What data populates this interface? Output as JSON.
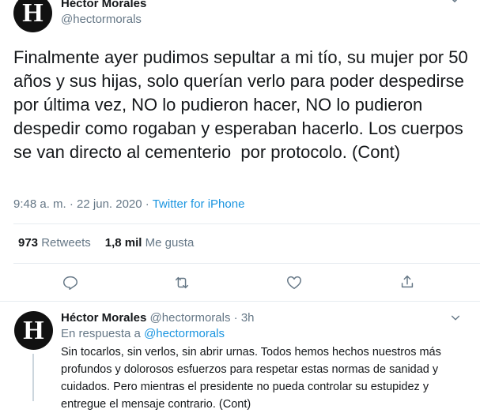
{
  "main_tweet": {
    "author_name": "Héctor Morales",
    "handle": "@hectormorals",
    "avatar_letter": "H",
    "text": "Finalmente ayer pudimos sepultar a mi tío, su mujer por 50 años y sus hijas, solo querían verlo para poder despedirse por última vez, NO lo pudieron hacer, NO lo pudieron despedir como rogaban y esperaban hacerlo. Los cuerpos se van directo al cementerio  por protocolo. (Cont)",
    "time": "9:48 a. m.",
    "separator": "·",
    "date": "22 jun. 2020",
    "source": "Twitter for iPhone",
    "retweets_count": "973",
    "retweets_label": "Retweets",
    "likes_count": "1,8 mil",
    "likes_label": "Me gusta"
  },
  "icons": {
    "chevron": "chevron-down-icon",
    "reply": "reply-icon",
    "retweet": "retweet-icon",
    "like": "heart-icon",
    "share": "share-icon"
  },
  "reply_tweet": {
    "author_name": "Héctor Morales",
    "handle": "@hectormorals",
    "separator": "·",
    "time_ago": "3h",
    "avatar_letter": "H",
    "in_reply_prefix": "En respuesta a",
    "in_reply_handle": "@hectormorals",
    "text": "Sin tocarlos, sin verlos, sin abrir urnas. Todos hemos hechos nuestros más profundos y dolorosos esfuerzos para respetar estas normas de sanidad y cuidados. Pero mientras el presidente no pueda controlar su estupidez y entregue el mensaje contrario.  (Cont)"
  },
  "colors": {
    "text": "#14171a",
    "muted": "#657786",
    "link": "#1b95e0",
    "border": "#e6ecf0"
  }
}
